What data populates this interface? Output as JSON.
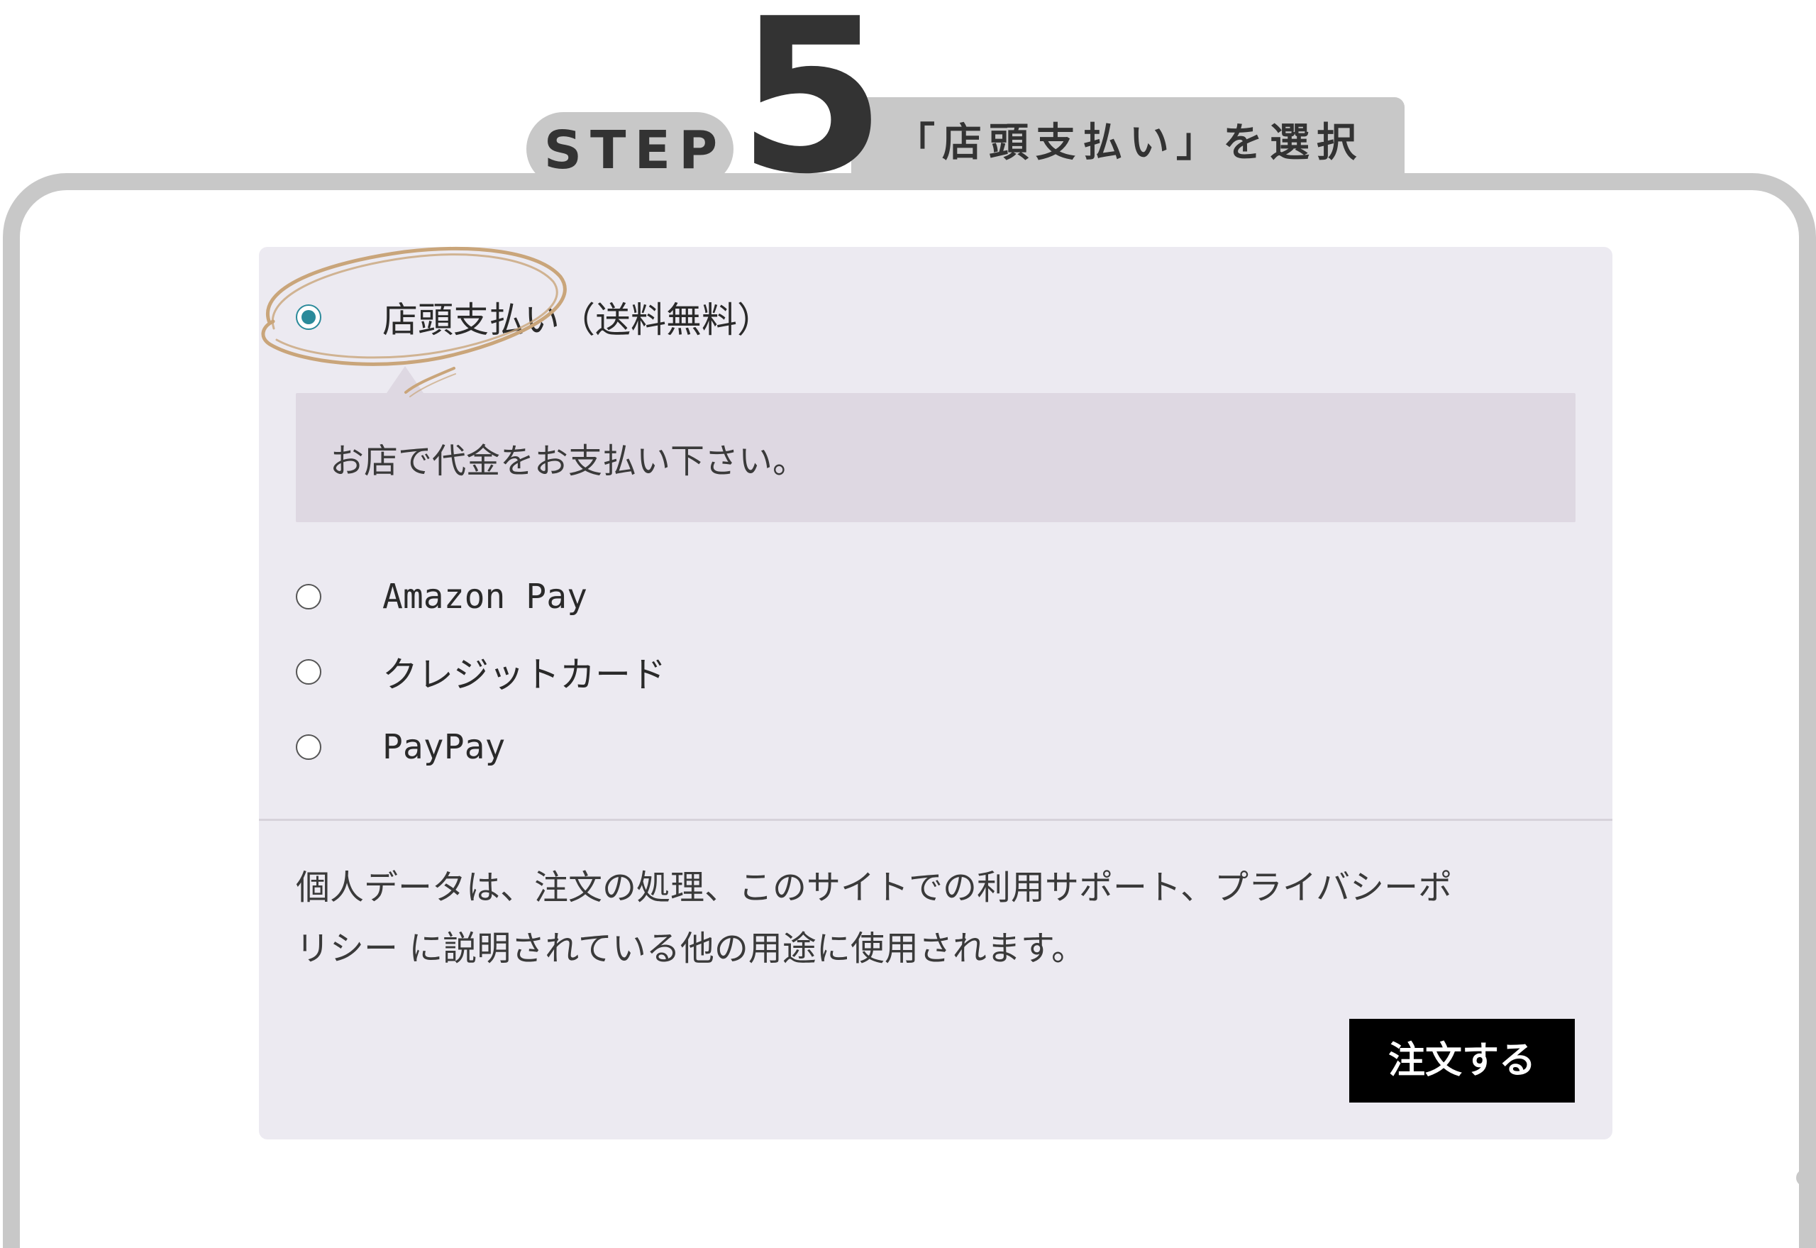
{
  "header": {
    "step_word": "STEP",
    "step_number": "5",
    "step_title": "「店頭支払い」を選択"
  },
  "payment": {
    "options": [
      {
        "label": "店頭支払い（送料無料）",
        "selected": true,
        "radio_icon": "radio-checked-icon"
      },
      {
        "label": "Amazon Pay",
        "selected": false,
        "radio_icon": "radio-unchecked-icon"
      },
      {
        "label": "クレジットカード",
        "selected": false,
        "radio_icon": "radio-unchecked-icon"
      },
      {
        "label": "PayPay",
        "selected": false,
        "radio_icon": "radio-unchecked-icon"
      }
    ],
    "selected_description": "お店で代金をお支払い下さい。"
  },
  "privacy": {
    "line1": "個人データは、注文の処理、このサイトでの利用サポート、プライバシーポ",
    "line2": "リシー に説明されている他の用途に使用されます。"
  },
  "order_button": {
    "label": "注文する"
  },
  "colors": {
    "frame": "#c8c8c8",
    "heading_text": "#333333",
    "box_background": "#eceaf1",
    "description_background": "#ded8e2",
    "radio_accent": "#2a8a9a",
    "button_background": "#000000",
    "button_text": "#ffffff",
    "highlight_scribble": "#c9a57a"
  }
}
